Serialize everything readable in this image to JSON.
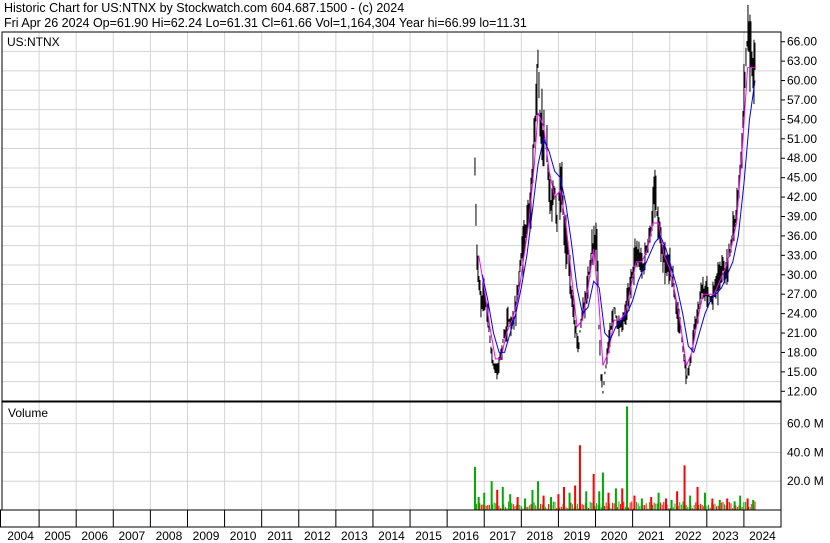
{
  "header": {
    "line1": "Historic Chart for US:NTNX by Stockwatch.com 604.687.1500 - (c) 2024",
    "line2": "Fri Apr 26 2024   Op=61.90   Hi=62.24   Lo=61.31   Cl=61.66   Vol=1,164,304   Year hi=66.99   lo=11.31"
  },
  "colors": {
    "price_bar": "#000000",
    "ma_short": "#ff00ff",
    "ma_long": "#0000ff",
    "vol_up": "#00aa00",
    "vol_down": "#ff0000",
    "grid": "#d4d4d4",
    "border": "#000000"
  },
  "chart_data": [
    {
      "type": "line",
      "panel": "price",
      "title": "US:NTNX",
      "ylim": [
        10.5,
        67.5
      ],
      "yticks": [
        "66.00",
        "63.00",
        "60.00",
        "57.00",
        "54.00",
        "51.00",
        "48.00",
        "45.00",
        "42.00",
        "39.00",
        "36.00",
        "33.00",
        "30.00",
        "27.00",
        "24.00",
        "21.00",
        "18.00",
        "15.00",
        "12.00"
      ],
      "grid": true,
      "series": [
        {
          "role": "close",
          "points": [
            [
              2016.75,
              46
            ],
            [
              2016.8,
              33
            ],
            [
              2016.9,
              26
            ],
            [
              2017.0,
              27
            ],
            [
              2017.1,
              24
            ],
            [
              2017.15,
              20
            ],
            [
              2017.25,
              16
            ],
            [
              2017.35,
              15
            ],
            [
              2017.45,
              18
            ],
            [
              2017.55,
              21
            ],
            [
              2017.65,
              23
            ],
            [
              2017.75,
              22
            ],
            [
              2017.85,
              25
            ],
            [
              2017.95,
              30
            ],
            [
              2018.05,
              34
            ],
            [
              2018.15,
              38
            ],
            [
              2018.25,
              40
            ],
            [
              2018.35,
              52
            ],
            [
              2018.4,
              57
            ],
            [
              2018.45,
              64
            ],
            [
              2018.5,
              53
            ],
            [
              2018.6,
              52
            ],
            [
              2018.7,
              48
            ],
            [
              2018.8,
              40
            ],
            [
              2018.9,
              44
            ],
            [
              2018.95,
              38
            ],
            [
              2019.0,
              42
            ],
            [
              2019.1,
              44
            ],
            [
              2019.15,
              37
            ],
            [
              2019.25,
              34
            ],
            [
              2019.35,
              27
            ],
            [
              2019.45,
              22
            ],
            [
              2019.55,
              19
            ],
            [
              2019.6,
              23
            ],
            [
              2019.7,
              25
            ],
            [
              2019.8,
              29
            ],
            [
              2019.9,
              34
            ],
            [
              2020.0,
              36
            ],
            [
              2020.05,
              33
            ],
            [
              2020.1,
              20
            ],
            [
              2020.15,
              14
            ],
            [
              2020.2,
              12
            ],
            [
              2020.3,
              17
            ],
            [
              2020.4,
              21
            ],
            [
              2020.5,
              25
            ],
            [
              2020.6,
              22
            ],
            [
              2020.7,
              22
            ],
            [
              2020.8,
              24
            ],
            [
              2020.9,
              27
            ],
            [
              2021.0,
              31
            ],
            [
              2021.1,
              33
            ],
            [
              2021.2,
              32
            ],
            [
              2021.3,
              31
            ],
            [
              2021.4,
              35
            ],
            [
              2021.5,
              37
            ],
            [
              2021.6,
              43
            ],
            [
              2021.7,
              37
            ],
            [
              2021.8,
              33
            ],
            [
              2021.9,
              31
            ],
            [
              2022.0,
              32
            ],
            [
              2022.1,
              28
            ],
            [
              2022.2,
              24
            ],
            [
              2022.3,
              22
            ],
            [
              2022.4,
              16
            ],
            [
              2022.45,
              14
            ],
            [
              2022.55,
              16
            ],
            [
              2022.65,
              21
            ],
            [
              2022.75,
              24
            ],
            [
              2022.85,
              27
            ],
            [
              2022.95,
              28
            ],
            [
              2023.05,
              27
            ],
            [
              2023.15,
              26
            ],
            [
              2023.2,
              28
            ],
            [
              2023.3,
              29
            ],
            [
              2023.4,
              31
            ],
            [
              2023.5,
              30
            ],
            [
              2023.6,
              33
            ],
            [
              2023.7,
              36
            ],
            [
              2023.8,
              40
            ],
            [
              2023.9,
              46
            ],
            [
              2024.0,
              58
            ],
            [
              2024.08,
              66
            ],
            [
              2024.15,
              65
            ],
            [
              2024.22,
              62
            ],
            [
              2024.3,
              61.66
            ]
          ]
        },
        {
          "role": "moving-average-short",
          "points": [
            [
              2016.85,
              33
            ],
            [
              2017.0,
              28
            ],
            [
              2017.15,
              22
            ],
            [
              2017.3,
              17
            ],
            [
              2017.45,
              17
            ],
            [
              2017.6,
              21
            ],
            [
              2017.75,
              23
            ],
            [
              2017.9,
              26
            ],
            [
              2018.05,
              32
            ],
            [
              2018.2,
              38
            ],
            [
              2018.35,
              47
            ],
            [
              2018.45,
              55
            ],
            [
              2018.6,
              53
            ],
            [
              2018.75,
              46
            ],
            [
              2018.9,
              42
            ],
            [
              2019.05,
              43
            ],
            [
              2019.2,
              38
            ],
            [
              2019.35,
              30
            ],
            [
              2019.5,
              22
            ],
            [
              2019.65,
              23
            ],
            [
              2019.8,
              28
            ],
            [
              2019.95,
              34
            ],
            [
              2020.1,
              25
            ],
            [
              2020.2,
              16
            ],
            [
              2020.35,
              18
            ],
            [
              2020.5,
              23
            ],
            [
              2020.65,
              23
            ],
            [
              2020.8,
              24
            ],
            [
              2020.95,
              28
            ],
            [
              2021.1,
              32
            ],
            [
              2021.25,
              32
            ],
            [
              2021.4,
              34
            ],
            [
              2021.55,
              38
            ],
            [
              2021.7,
              38
            ],
            [
              2021.85,
              33
            ],
            [
              2022.0,
              31
            ],
            [
              2022.15,
              27
            ],
            [
              2022.3,
              22
            ],
            [
              2022.45,
              16
            ],
            [
              2022.6,
              18
            ],
            [
              2022.75,
              23
            ],
            [
              2022.9,
              27
            ],
            [
              2023.05,
              27
            ],
            [
              2023.2,
              27
            ],
            [
              2023.35,
              29
            ],
            [
              2023.5,
              31
            ],
            [
              2023.65,
              34
            ],
            [
              2023.8,
              38
            ],
            [
              2023.95,
              49
            ],
            [
              2024.1,
              62
            ],
            [
              2024.3,
              62
            ]
          ]
        },
        {
          "role": "moving-average-long",
          "points": [
            [
              2016.95,
              30
            ],
            [
              2017.1,
              26
            ],
            [
              2017.25,
              21
            ],
            [
              2017.4,
              18
            ],
            [
              2017.55,
              18
            ],
            [
              2017.7,
              21
            ],
            [
              2017.85,
              24
            ],
            [
              2018.0,
              28
            ],
            [
              2018.15,
              33
            ],
            [
              2018.3,
              40
            ],
            [
              2018.45,
              47
            ],
            [
              2018.6,
              51
            ],
            [
              2018.75,
              49
            ],
            [
              2018.9,
              46
            ],
            [
              2019.05,
              45
            ],
            [
              2019.2,
              41
            ],
            [
              2019.35,
              35
            ],
            [
              2019.5,
              28
            ],
            [
              2019.65,
              24
            ],
            [
              2019.8,
              25
            ],
            [
              2019.95,
              29
            ],
            [
              2020.1,
              28
            ],
            [
              2020.25,
              21
            ],
            [
              2020.4,
              20
            ],
            [
              2020.55,
              22
            ],
            [
              2020.7,
              23
            ],
            [
              2020.85,
              24
            ],
            [
              2021.0,
              26
            ],
            [
              2021.15,
              29
            ],
            [
              2021.3,
              31
            ],
            [
              2021.45,
              33
            ],
            [
              2021.6,
              35
            ],
            [
              2021.75,
              36
            ],
            [
              2021.9,
              34
            ],
            [
              2022.05,
              31
            ],
            [
              2022.2,
              28
            ],
            [
              2022.35,
              24
            ],
            [
              2022.5,
              19
            ],
            [
              2022.65,
              18
            ],
            [
              2022.8,
              21
            ],
            [
              2022.95,
              24
            ],
            [
              2023.1,
              26
            ],
            [
              2023.25,
              27
            ],
            [
              2023.4,
              28
            ],
            [
              2023.55,
              30
            ],
            [
              2023.7,
              32
            ],
            [
              2023.85,
              36
            ],
            [
              2024.0,
              44
            ],
            [
              2024.15,
              54
            ],
            [
              2024.3,
              60
            ]
          ]
        }
      ]
    },
    {
      "type": "bar",
      "panel": "volume",
      "title": "Volume",
      "ylim": [
        0,
        75
      ],
      "yticks": [
        "60.0 M",
        "40.0 M",
        "20.0 M"
      ],
      "grid": true,
      "spikes": [
        [
          2016.75,
          30,
          "up"
        ],
        [
          2016.85,
          9,
          "up"
        ],
        [
          2017.0,
          12,
          "up"
        ],
        [
          2017.2,
          20,
          "up"
        ],
        [
          2017.35,
          14,
          "down"
        ],
        [
          2017.5,
          16,
          "up"
        ],
        [
          2017.7,
          11,
          "up"
        ],
        [
          2017.9,
          9,
          "down"
        ],
        [
          2018.1,
          8,
          "up"
        ],
        [
          2018.3,
          14,
          "up"
        ],
        [
          2018.45,
          20,
          "up"
        ],
        [
          2018.6,
          10,
          "down"
        ],
        [
          2018.8,
          9,
          "up"
        ],
        [
          2019.0,
          11,
          "down"
        ],
        [
          2019.15,
          16,
          "down"
        ],
        [
          2019.3,
          12,
          "up"
        ],
        [
          2019.45,
          17,
          "down"
        ],
        [
          2019.58,
          45,
          "down"
        ],
        [
          2019.75,
          13,
          "up"
        ],
        [
          2019.95,
          25,
          "down"
        ],
        [
          2020.1,
          13,
          "up"
        ],
        [
          2020.2,
          26,
          "up"
        ],
        [
          2020.35,
          12,
          "down"
        ],
        [
          2020.55,
          15,
          "up"
        ],
        [
          2020.72,
          15,
          "down"
        ],
        [
          2020.85,
          72,
          "up"
        ],
        [
          2021.05,
          10,
          "down"
        ],
        [
          2021.25,
          8,
          "up"
        ],
        [
          2021.5,
          9,
          "down"
        ],
        [
          2021.7,
          12,
          "up"
        ],
        [
          2021.9,
          8,
          "down"
        ],
        [
          2022.05,
          7,
          "up"
        ],
        [
          2022.2,
          13,
          "down"
        ],
        [
          2022.4,
          31,
          "down"
        ],
        [
          2022.55,
          10,
          "up"
        ],
        [
          2022.75,
          16,
          "down"
        ],
        [
          2022.95,
          12,
          "up"
        ],
        [
          2023.15,
          8,
          "down"
        ],
        [
          2023.35,
          7,
          "up"
        ],
        [
          2023.55,
          8,
          "down"
        ],
        [
          2023.75,
          6,
          "up"
        ],
        [
          2023.9,
          10,
          "up"
        ],
        [
          2024.1,
          8,
          "down"
        ],
        [
          2024.25,
          7,
          "up"
        ]
      ]
    }
  ],
  "x_axis": {
    "labels": [
      "2004",
      "2005",
      "2006",
      "2007",
      "2008",
      "2009",
      "2010",
      "2011",
      "2012",
      "2013",
      "2014",
      "2015",
      "2016",
      "2017",
      "2018",
      "2019",
      "2020",
      "2021",
      "2022",
      "2023",
      "2024"
    ]
  }
}
